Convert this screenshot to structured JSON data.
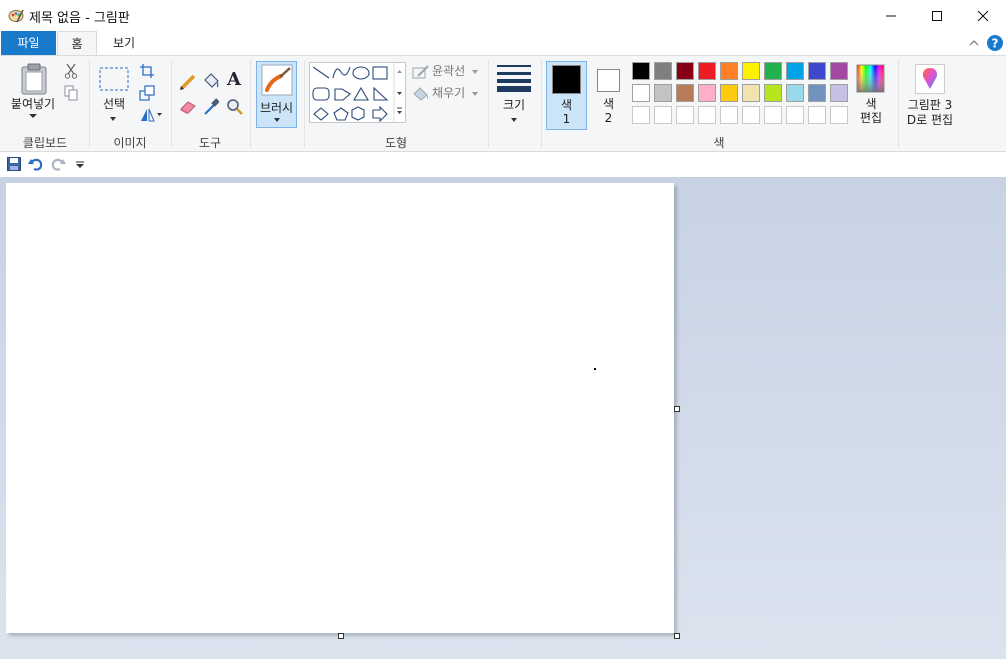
{
  "window": {
    "title": "제목 없음 - 그림판"
  },
  "tabs": {
    "file": "파일",
    "home": "홈",
    "view": "보기"
  },
  "ribbon": {
    "clipboard": {
      "paste": "붙여넣기",
      "label": "클립보드"
    },
    "image": {
      "select": "선택",
      "label": "이미지"
    },
    "tools": {
      "label": "도구"
    },
    "brush": {
      "label": "브러시"
    },
    "shapes": {
      "outline": "윤곽선",
      "fill": "채우기",
      "label": "도형"
    },
    "size": {
      "label": "크기"
    },
    "colors": {
      "color1_a": "색",
      "color1_b": "1",
      "color2_a": "색",
      "color2_b": "2",
      "edit_a": "색",
      "edit_b": "편집",
      "label": "색",
      "color1_value": "#000000",
      "color2_value": "#ffffff",
      "palette_row1": [
        "#000000",
        "#7f7f7f",
        "#880015",
        "#ed1c24",
        "#ff7f27",
        "#fff200",
        "#22b14c",
        "#00a2e8",
        "#3f48cc",
        "#a349a4"
      ],
      "palette_row2": [
        "#ffffff",
        "#c3c3c3",
        "#b97a57",
        "#ffaec9",
        "#ffc90e",
        "#efe4b0",
        "#b5e61d",
        "#99d9ea",
        "#7092be",
        "#c8bfe7"
      ],
      "palette_row3": [
        "#ffffff",
        "#ffffff",
        "#ffffff",
        "#ffffff",
        "#ffffff",
        "#ffffff",
        "#ffffff",
        "#ffffff",
        "#ffffff",
        "#ffffff"
      ]
    },
    "paint3d": {
      "line1": "그림판 3",
      "line2": "D로 편집"
    }
  },
  "icons": [
    "app-icon",
    "minimize-icon",
    "maximize-icon",
    "close-icon",
    "help-icon",
    "collapse-ribbon-icon",
    "paste-icon",
    "cut-icon",
    "copy-icon",
    "select-icon",
    "crop-icon",
    "resize-icon",
    "rotate-icon",
    "pencil-icon",
    "fill-icon",
    "text-icon",
    "eraser-icon",
    "color-picker-icon",
    "magnifier-icon",
    "brush-icon",
    "size-icon",
    "edit-colors-icon",
    "paint3d-icon",
    "save-icon",
    "undo-icon",
    "redo-icon",
    "customize-qat-icon"
  ]
}
